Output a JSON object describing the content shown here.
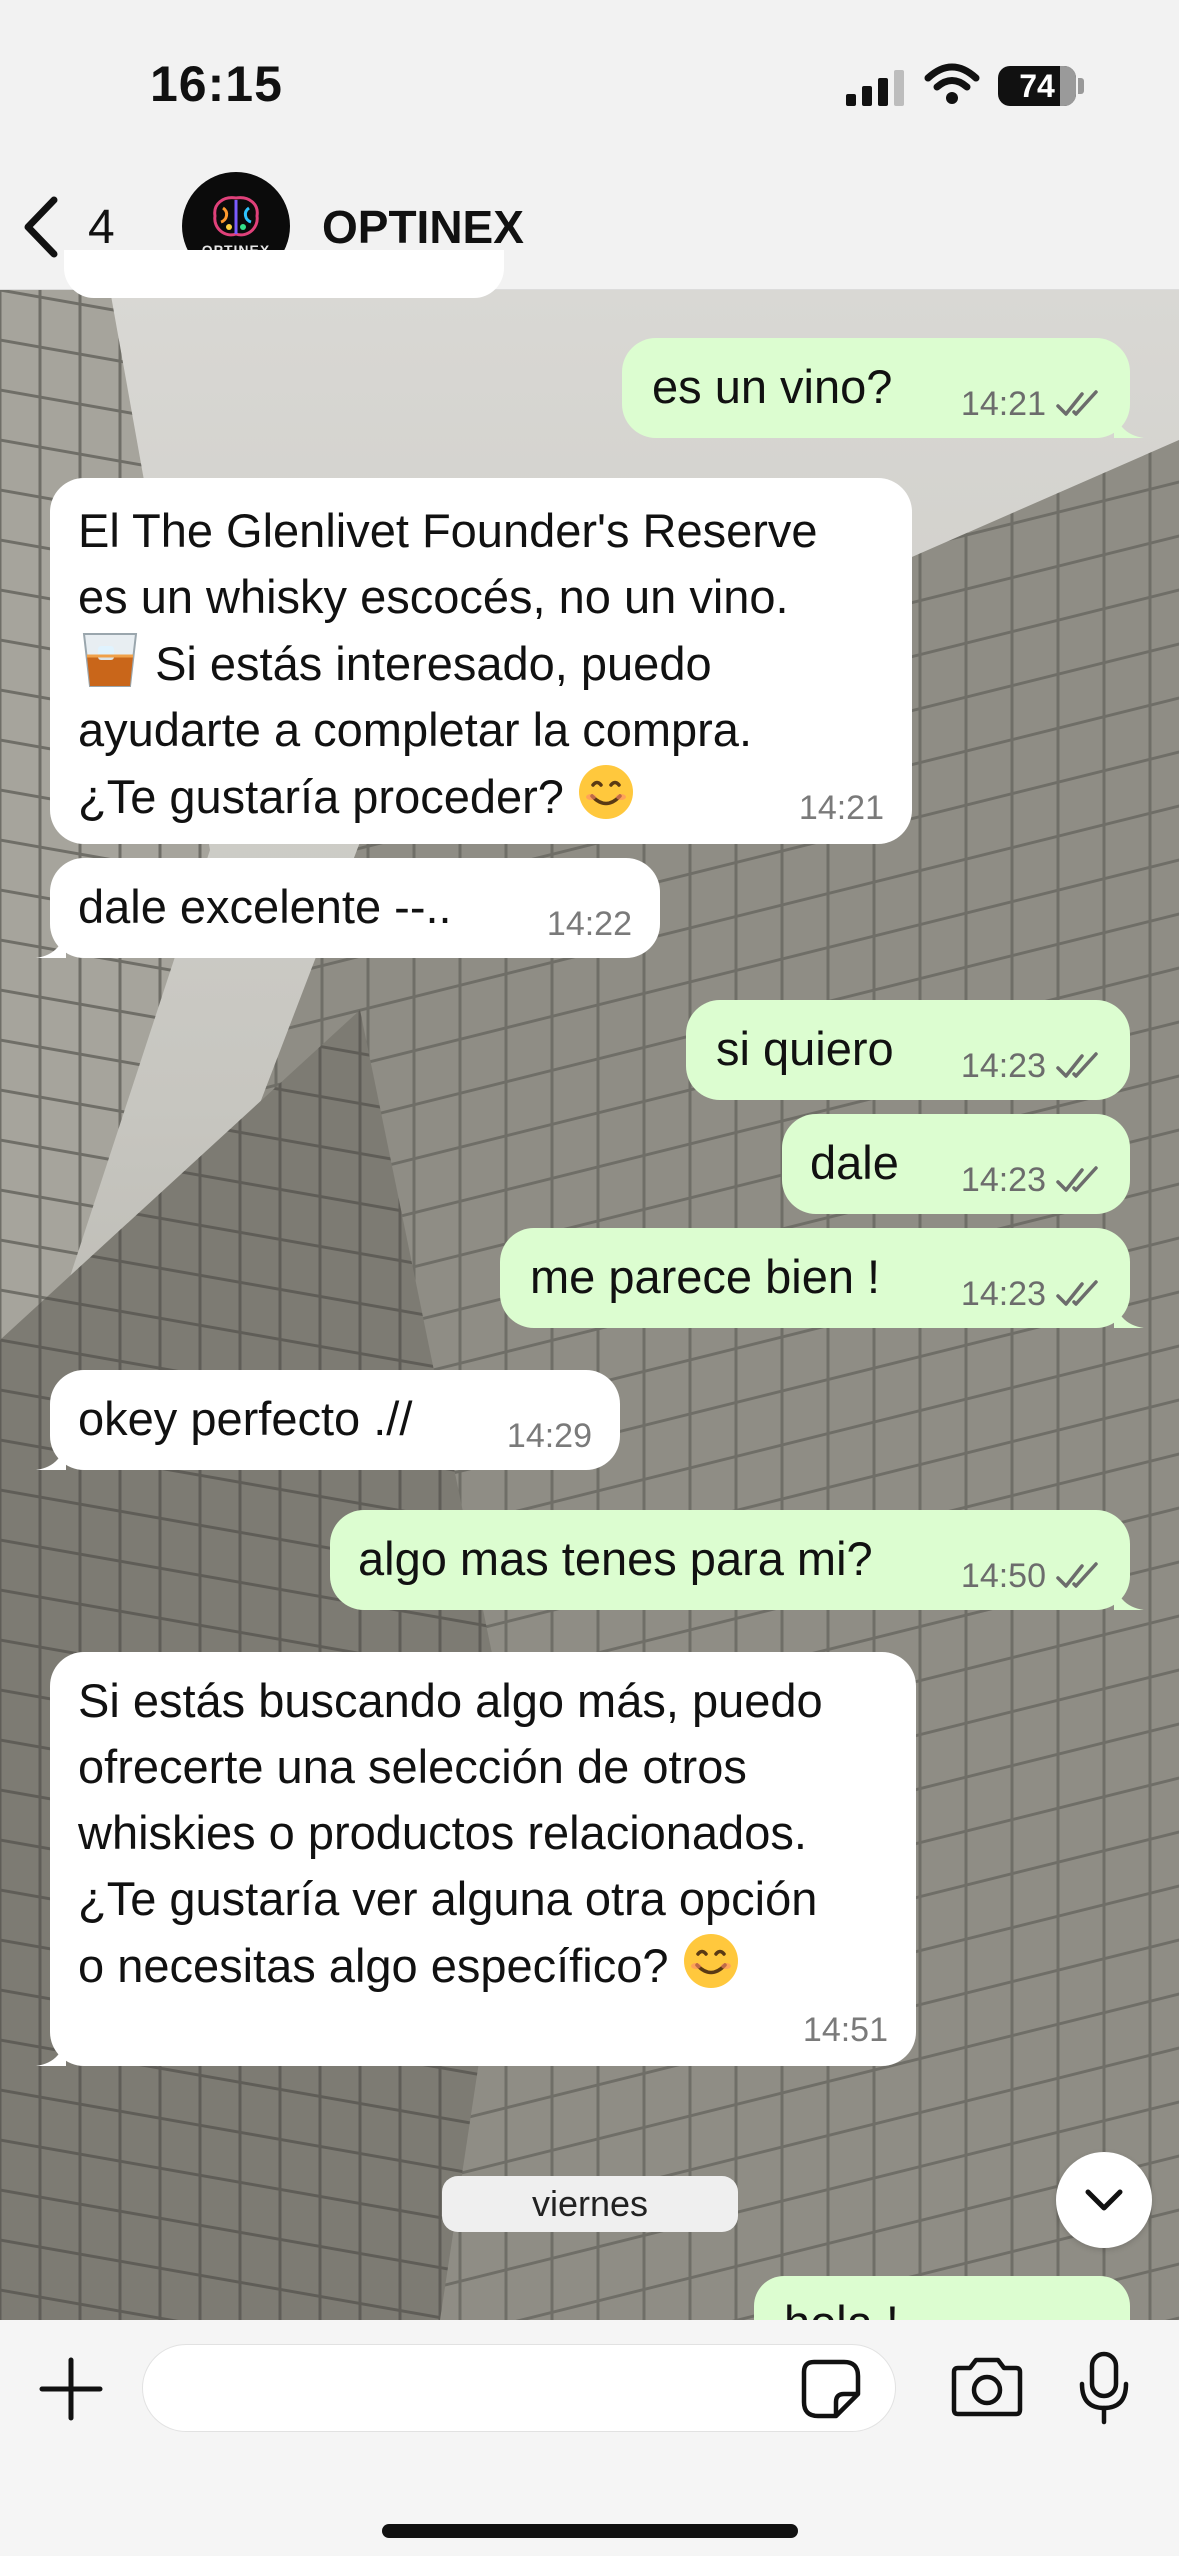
{
  "status_bar": {
    "time": "16:15",
    "battery": "74"
  },
  "header": {
    "back_count": "4",
    "contact_name": "OPTINEX",
    "avatar_label": "OPTINEX"
  },
  "messages": [
    {
      "direction": "out",
      "text": "es un vino?",
      "time": "14:21",
      "status": "read"
    },
    {
      "direction": "in",
      "lines": [
        "El The Glenlivet Founder's Reserve",
        "es un whisky escocés, no un vino.",
        "Si estás interesado, puedo",
        "ayudarte a completar la compra.",
        "¿Te gustaría proceder?"
      ],
      "time": "14:21"
    },
    {
      "direction": "in",
      "text": "dale excelente --..",
      "time": "14:22"
    },
    {
      "direction": "out",
      "text": "si quiero",
      "time": "14:23",
      "status": "read"
    },
    {
      "direction": "out",
      "text": "dale",
      "time": "14:23",
      "status": "read"
    },
    {
      "direction": "out",
      "text": "me parece bien !",
      "time": "14:23",
      "status": "read"
    },
    {
      "direction": "in",
      "text": "okey perfecto .//",
      "time": "14:29"
    },
    {
      "direction": "out",
      "text": "algo mas tenes para mi?",
      "time": "14:50",
      "status": "read"
    },
    {
      "direction": "in",
      "lines": [
        "Si estás buscando algo más, puedo",
        "ofrecerte una selección de otros",
        "whiskies o productos relacionados.",
        "¿Te gustaría ver alguna otra opción",
        "o necesitas algo específico?"
      ],
      "time": "14:51"
    },
    {
      "direction": "out",
      "text": "hola !",
      "partial": true
    }
  ],
  "day_separator": "viernes",
  "composer": {
    "input_value": ""
  },
  "icons": [
    "back-chevron-icon",
    "smile-emoji-icon",
    "whisky-glass-emoji-icon",
    "double-check-icon",
    "chevron-down-icon",
    "plus-icon",
    "sticker-icon",
    "camera-icon",
    "microphone-icon"
  ],
  "colors": {
    "outgoing_bubble": "#dcfdd0",
    "incoming_bubble": "#ffffff",
    "read_tick": "#6c6c6c"
  }
}
